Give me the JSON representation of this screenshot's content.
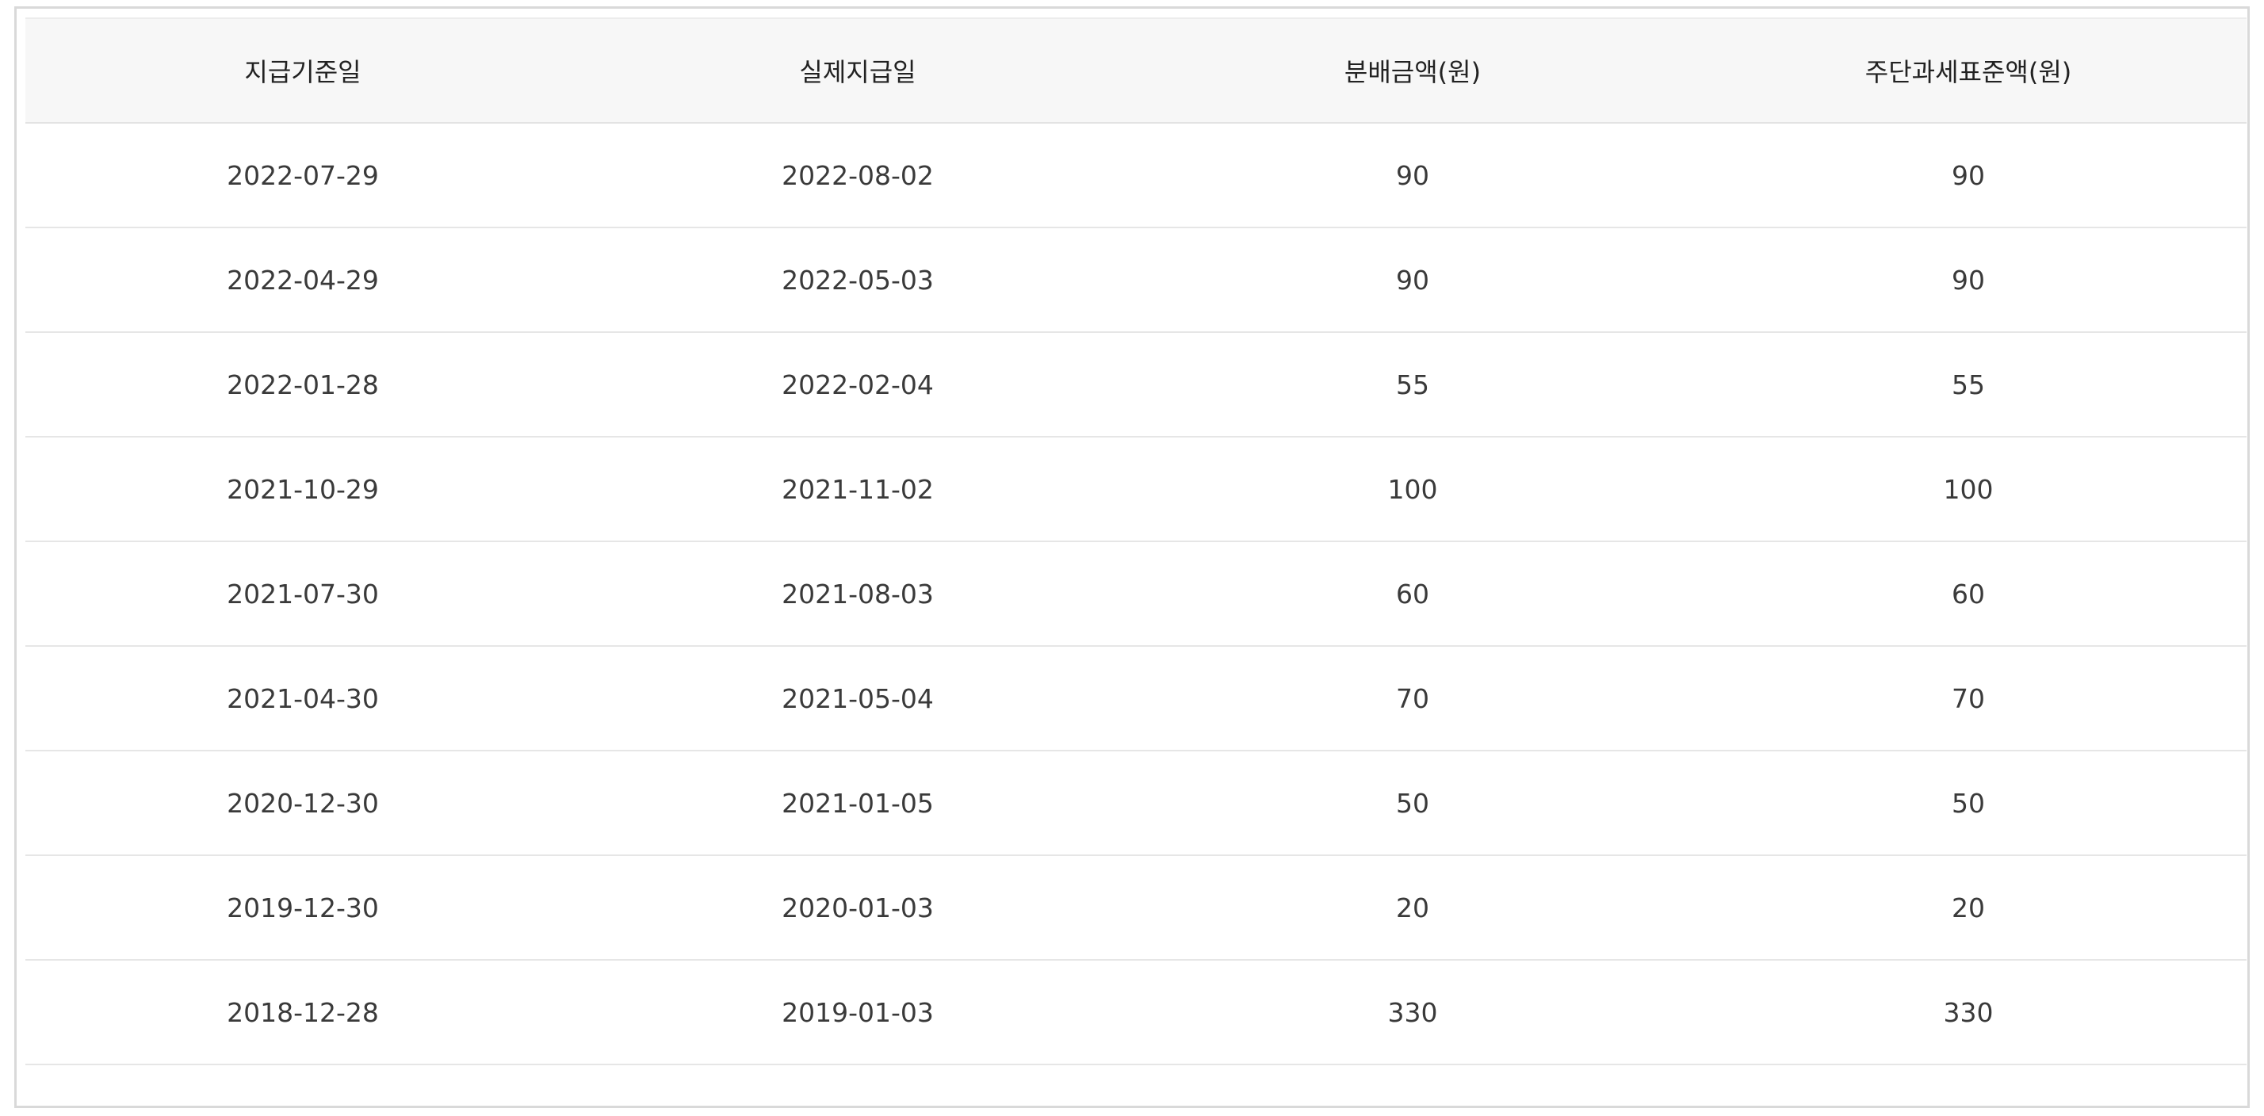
{
  "table": {
    "headers": [
      "지급기준일",
      "실제지급일",
      "분배금액(원)",
      "주단과세표준액(원)"
    ],
    "rows": [
      [
        "2022-07-29",
        "2022-08-02",
        "90",
        "90"
      ],
      [
        "2022-04-29",
        "2022-05-03",
        "90",
        "90"
      ],
      [
        "2022-01-28",
        "2022-02-04",
        "55",
        "55"
      ],
      [
        "2021-10-29",
        "2021-11-02",
        "100",
        "100"
      ],
      [
        "2021-07-30",
        "2021-08-03",
        "60",
        "60"
      ],
      [
        "2021-04-30",
        "2021-05-04",
        "70",
        "70"
      ],
      [
        "2020-12-30",
        "2021-01-05",
        "50",
        "50"
      ],
      [
        "2019-12-30",
        "2020-01-03",
        "20",
        "20"
      ],
      [
        "2018-12-28",
        "2019-01-03",
        "330",
        "330"
      ]
    ]
  }
}
